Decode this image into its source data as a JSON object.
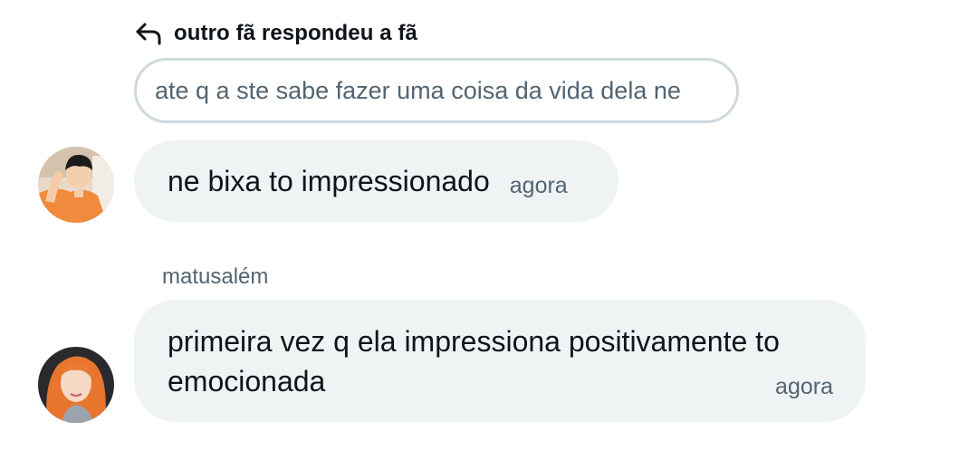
{
  "reply_context": {
    "icon": "reply-arrow-icon",
    "label": "outro fã respondeu a fã",
    "quoted_text": "ate q a ste sabe fazer uma coisa da vida dela ne"
  },
  "messages": [
    {
      "avatar_icon": "user-avatar-orange-shirt",
      "text": "ne bixa to impressionado",
      "time": "agora"
    },
    {
      "sender": "matusalém",
      "avatar_icon": "user-avatar-orange-hair",
      "text": "primeira vez q ela impressiona positivamente to emocionada",
      "time": "agora"
    }
  ],
  "colors": {
    "bubble_bg": "#eff3f4",
    "quote_border": "#cfd9de",
    "primary_text": "#0f1419",
    "secondary_text": "#536471"
  }
}
